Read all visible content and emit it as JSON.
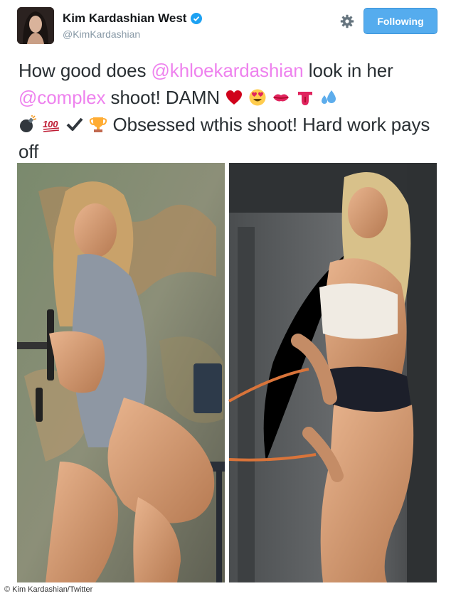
{
  "tweet": {
    "display_name": "Kim Kardashian West",
    "handle": "@KimKardashian",
    "follow_label": "Following",
    "text_parts": {
      "p1": "How good does ",
      "mention1": "@khloekardashian",
      "p2": " look in her ",
      "mention2": "@complex",
      "p3": " shoot! DAMN ",
      "p4": " Obsessed wthis shoot! Hard work pays off"
    },
    "emojis": [
      "heart-icon",
      "heart-eyes-icon",
      "kiss-lips-icon",
      "tongue-icon",
      "sweat-droplets-icon",
      "bomb-icon",
      "hundred-points-icon",
      "check-mark-icon",
      "trophy-icon"
    ]
  },
  "photo_caption": "© Kim Kardashian/Twitter",
  "colors": {
    "follow_button": "#55acee",
    "mention": "#ee82ee",
    "verified": "#1da1f2"
  }
}
